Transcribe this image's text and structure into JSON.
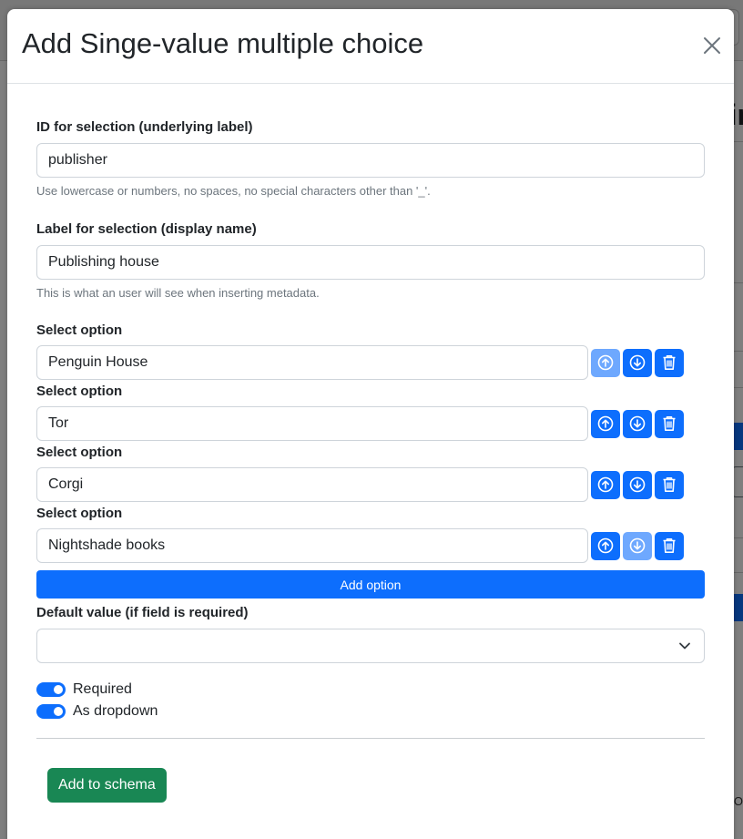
{
  "background": {
    "heading_fragment": "ir",
    "text_fragment": "RO"
  },
  "modal": {
    "title": "Add Singe-value multiple choice",
    "close_icon": "close-icon"
  },
  "form": {
    "id_field": {
      "label": "ID for selection (underlying label)",
      "value": "publisher",
      "help": "Use lowercase or numbers, no spaces, no special characters other than '_'."
    },
    "display_field": {
      "label": "Label for selection (display name)",
      "value": "Publishing house",
      "help": "This is what an user will see when inserting metadata."
    },
    "options": [
      {
        "label": "Select option",
        "value": "Penguin House",
        "up_disabled": true,
        "down_disabled": false
      },
      {
        "label": "Select option",
        "value": "Tor",
        "up_disabled": false,
        "down_disabled": false
      },
      {
        "label": "Select option",
        "value": "Corgi",
        "up_disabled": false,
        "down_disabled": false
      },
      {
        "label": "Select option",
        "value": "Nightshade books",
        "up_disabled": false,
        "down_disabled": true
      }
    ],
    "option_icons": [
      "arrow-up-circle-icon",
      "arrow-down-circle-icon",
      "trash-icon"
    ],
    "add_option_label": "Add option",
    "default_value": {
      "label": "Default value (if field is required)",
      "selected": ""
    },
    "switches": [
      {
        "label": "Required",
        "checked": true
      },
      {
        "label": "As dropdown",
        "checked": true
      }
    ],
    "submit_label": "Add to schema"
  },
  "colors": {
    "primary": "#0d6efd",
    "primary_disabled": "#6ea8fe",
    "success": "#198754",
    "backdrop": "rgba(0,0,0,0.5)"
  }
}
